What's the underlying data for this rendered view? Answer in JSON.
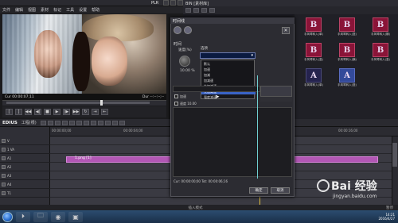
{
  "main": {
    "plr_label": "PLR",
    "menu": [
      "文件",
      "编辑",
      "视图",
      "素材",
      "标记",
      "工具",
      "设置",
      "帮助"
    ]
  },
  "player": {
    "tc_in": "Cur 00:00:07;11",
    "tc_out": "Dur --:--:--;--"
  },
  "timeline": {
    "app_label": "EDIUS",
    "project": "工程(根)",
    "ruler": [
      "00:00:00;00",
      "00:00:04;00",
      "00:00:08;00",
      "00:00:12;00",
      "00:00:16;00"
    ],
    "tracks": [
      "V",
      "1 VA",
      "A1",
      "A2",
      "A3",
      "A4",
      "T1"
    ],
    "clip_label": "1.png [1]",
    "status_left": "",
    "status_mid": "插入模式",
    "status_right": "暂停"
  },
  "bin": {
    "title": "BIN  [素材库]",
    "items": [
      {
        "letter": "B",
        "caption": "手风琴转入(单)",
        "color": "red"
      },
      {
        "letter": "B",
        "caption": "手风琴转入(竖)",
        "color": "red"
      },
      {
        "letter": "B",
        "caption": "手风琴转入(横)",
        "color": "red"
      },
      {
        "letter": "B",
        "caption": "手风琴转入(竖)",
        "color": "red"
      },
      {
        "letter": "B",
        "caption": "手风琴转入(横)",
        "color": "red"
      },
      {
        "letter": "B",
        "caption": "手风琴转入(竖)",
        "color": "red"
      },
      {
        "letter": "A",
        "caption": "手风琴转入(单)",
        "color": "blue"
      },
      {
        "letter": "A",
        "caption": "手风琴转入(竖)",
        "color": "blue2"
      }
    ]
  },
  "dialog": {
    "title": "时间线",
    "label_time": "时间",
    "label_speed": "速度(%)",
    "knob_value": "10.00 %",
    "label_option": "选项",
    "options": [
      "默认",
      "加速",
      "加减",
      "加减速",
      "先加减速",
      "先加减速",
      "强度减速"
    ],
    "selected_index": 5,
    "row_a": "加速",
    "row_b": "速度 10.00",
    "timecode": "Cur: 00:00:00;00  Tot: 00:00:06;16",
    "ok": "确定",
    "cancel": "取消"
  },
  "taskbar": {
    "time": "14:21",
    "date": "2016/4/27"
  },
  "watermark": {
    "brand": "Bai 经验",
    "url": "jingyan.baidu.com"
  }
}
